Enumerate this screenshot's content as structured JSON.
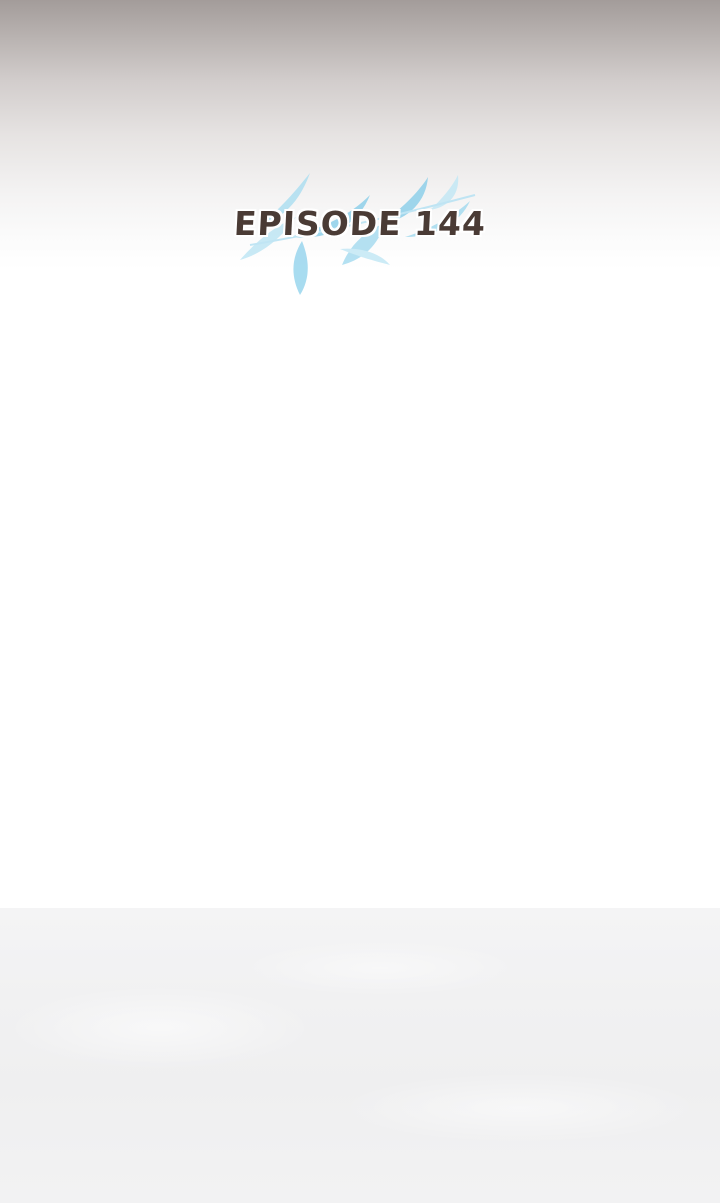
{
  "episode": {
    "title": "EPISODE 144"
  },
  "decoration": {
    "icon": "leaf-branch-icon",
    "leaf_color": "#8fd0ea",
    "leaf_color_light": "#c4e8f5"
  },
  "colors": {
    "title_text": "#4a3b35",
    "top_shade": "#a39c9a",
    "bottom_panel": "#f1f1f2"
  }
}
